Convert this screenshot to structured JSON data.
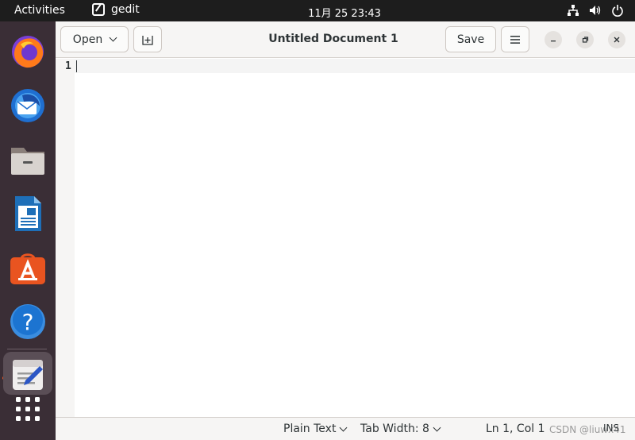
{
  "topbar": {
    "activities": "Activities",
    "app_name": "gedit",
    "clock": "11月 25  23:43"
  },
  "dock": {
    "items": [
      "firefox-icon",
      "thunderbird-icon",
      "files-icon",
      "libreoffice-writer-icon",
      "ubuntu-software-icon",
      "help-icon",
      "text-editor-icon",
      "show-apps-icon"
    ]
  },
  "header": {
    "open_label": "Open",
    "title": "Untitled Document 1",
    "save_label": "Save"
  },
  "editor": {
    "line_number": "1",
    "content": ""
  },
  "statusbar": {
    "language": "Plain Text",
    "tab_width": "Tab Width: 8",
    "position": "Ln 1, Col 1",
    "mode": "INS",
    "watermark": "CSDN @liuwx41"
  },
  "colors": {
    "topbar": "#1d1d1d",
    "dock": "#3a2e36",
    "accent": "#e95420"
  }
}
